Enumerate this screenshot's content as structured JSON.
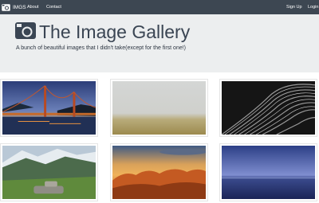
{
  "navbar": {
    "brand": "IMGS",
    "links": [
      "About",
      "Contact"
    ],
    "sign_up": "Sign Up",
    "login": "Login"
  },
  "hero": {
    "title": "The Image Gallery",
    "subtitle": "A bunch of beautiful images that I didn't take(except for the first one!)"
  },
  "gallery": {
    "images": [
      {
        "subject": "golden-gate-bridge-at-dusk"
      },
      {
        "subject": "foggy-field"
      },
      {
        "subject": "abstract-curved-architecture"
      },
      {
        "subject": "green-mountain-valley"
      },
      {
        "subject": "sunset-over-clouds"
      },
      {
        "subject": "ocean-horizon-at-dusk"
      }
    ]
  }
}
